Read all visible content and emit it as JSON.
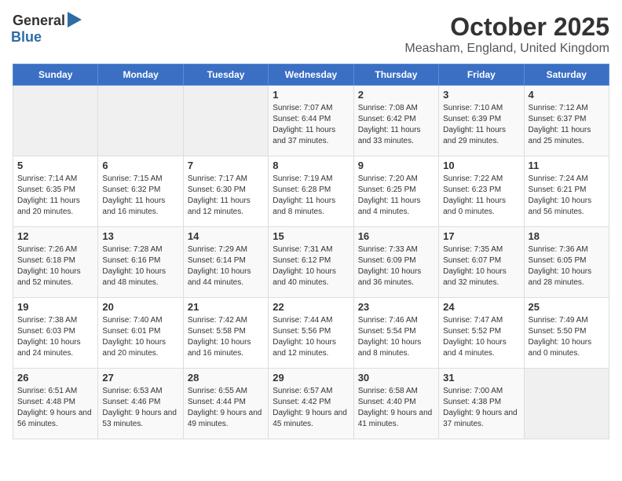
{
  "logo": {
    "general": "General",
    "blue": "Blue"
  },
  "title": "October 2025",
  "subtitle": "Measham, England, United Kingdom",
  "days_of_week": [
    "Sunday",
    "Monday",
    "Tuesday",
    "Wednesday",
    "Thursday",
    "Friday",
    "Saturday"
  ],
  "weeks": [
    [
      {
        "day": "",
        "empty": true
      },
      {
        "day": "",
        "empty": true
      },
      {
        "day": "",
        "empty": true
      },
      {
        "day": "1",
        "sunrise": "7:07 AM",
        "sunset": "6:44 PM",
        "daylight": "11 hours and 37 minutes."
      },
      {
        "day": "2",
        "sunrise": "7:08 AM",
        "sunset": "6:42 PM",
        "daylight": "11 hours and 33 minutes."
      },
      {
        "day": "3",
        "sunrise": "7:10 AM",
        "sunset": "6:39 PM",
        "daylight": "11 hours and 29 minutes."
      },
      {
        "day": "4",
        "sunrise": "7:12 AM",
        "sunset": "6:37 PM",
        "daylight": "11 hours and 25 minutes."
      }
    ],
    [
      {
        "day": "5",
        "sunrise": "7:14 AM",
        "sunset": "6:35 PM",
        "daylight": "11 hours and 20 minutes."
      },
      {
        "day": "6",
        "sunrise": "7:15 AM",
        "sunset": "6:32 PM",
        "daylight": "11 hours and 16 minutes."
      },
      {
        "day": "7",
        "sunrise": "7:17 AM",
        "sunset": "6:30 PM",
        "daylight": "11 hours and 12 minutes."
      },
      {
        "day": "8",
        "sunrise": "7:19 AM",
        "sunset": "6:28 PM",
        "daylight": "11 hours and 8 minutes."
      },
      {
        "day": "9",
        "sunrise": "7:20 AM",
        "sunset": "6:25 PM",
        "daylight": "11 hours and 4 minutes."
      },
      {
        "day": "10",
        "sunrise": "7:22 AM",
        "sunset": "6:23 PM",
        "daylight": "11 hours and 0 minutes."
      },
      {
        "day": "11",
        "sunrise": "7:24 AM",
        "sunset": "6:21 PM",
        "daylight": "10 hours and 56 minutes."
      }
    ],
    [
      {
        "day": "12",
        "sunrise": "7:26 AM",
        "sunset": "6:18 PM",
        "daylight": "10 hours and 52 minutes."
      },
      {
        "day": "13",
        "sunrise": "7:28 AM",
        "sunset": "6:16 PM",
        "daylight": "10 hours and 48 minutes."
      },
      {
        "day": "14",
        "sunrise": "7:29 AM",
        "sunset": "6:14 PM",
        "daylight": "10 hours and 44 minutes."
      },
      {
        "day": "15",
        "sunrise": "7:31 AM",
        "sunset": "6:12 PM",
        "daylight": "10 hours and 40 minutes."
      },
      {
        "day": "16",
        "sunrise": "7:33 AM",
        "sunset": "6:09 PM",
        "daylight": "10 hours and 36 minutes."
      },
      {
        "day": "17",
        "sunrise": "7:35 AM",
        "sunset": "6:07 PM",
        "daylight": "10 hours and 32 minutes."
      },
      {
        "day": "18",
        "sunrise": "7:36 AM",
        "sunset": "6:05 PM",
        "daylight": "10 hours and 28 minutes."
      }
    ],
    [
      {
        "day": "19",
        "sunrise": "7:38 AM",
        "sunset": "6:03 PM",
        "daylight": "10 hours and 24 minutes."
      },
      {
        "day": "20",
        "sunrise": "7:40 AM",
        "sunset": "6:01 PM",
        "daylight": "10 hours and 20 minutes."
      },
      {
        "day": "21",
        "sunrise": "7:42 AM",
        "sunset": "5:58 PM",
        "daylight": "10 hours and 16 minutes."
      },
      {
        "day": "22",
        "sunrise": "7:44 AM",
        "sunset": "5:56 PM",
        "daylight": "10 hours and 12 minutes."
      },
      {
        "day": "23",
        "sunrise": "7:46 AM",
        "sunset": "5:54 PM",
        "daylight": "10 hours and 8 minutes."
      },
      {
        "day": "24",
        "sunrise": "7:47 AM",
        "sunset": "5:52 PM",
        "daylight": "10 hours and 4 minutes."
      },
      {
        "day": "25",
        "sunrise": "7:49 AM",
        "sunset": "5:50 PM",
        "daylight": "10 hours and 0 minutes."
      }
    ],
    [
      {
        "day": "26",
        "sunrise": "6:51 AM",
        "sunset": "4:48 PM",
        "daylight": "9 hours and 56 minutes."
      },
      {
        "day": "27",
        "sunrise": "6:53 AM",
        "sunset": "4:46 PM",
        "daylight": "9 hours and 53 minutes."
      },
      {
        "day": "28",
        "sunrise": "6:55 AM",
        "sunset": "4:44 PM",
        "daylight": "9 hours and 49 minutes."
      },
      {
        "day": "29",
        "sunrise": "6:57 AM",
        "sunset": "4:42 PM",
        "daylight": "9 hours and 45 minutes."
      },
      {
        "day": "30",
        "sunrise": "6:58 AM",
        "sunset": "4:40 PM",
        "daylight": "9 hours and 41 minutes."
      },
      {
        "day": "31",
        "sunrise": "7:00 AM",
        "sunset": "4:38 PM",
        "daylight": "9 hours and 37 minutes."
      },
      {
        "day": "",
        "empty": true
      }
    ]
  ]
}
